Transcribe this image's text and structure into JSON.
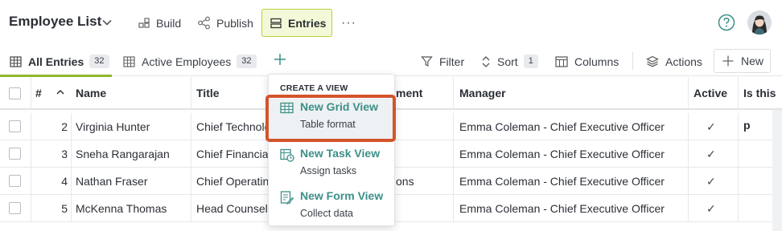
{
  "header": {
    "title": "Employee List",
    "build_label": "Build",
    "publish_label": "Publish",
    "entries_label": "Entries",
    "more_label": "···"
  },
  "views": {
    "tabs": [
      {
        "label": "All Entries",
        "count": "32",
        "active": true
      },
      {
        "label": "Active Employees",
        "count": "32",
        "active": false
      }
    ]
  },
  "toolbar": {
    "filter_label": "Filter",
    "sort_label": "Sort",
    "sort_count": "1",
    "columns_label": "Columns",
    "actions_label": "Actions",
    "new_label": "New"
  },
  "grid": {
    "columns": [
      "#",
      "Name",
      "Title",
      "ment",
      "Manager",
      "Active",
      "Is this p"
    ],
    "rows": [
      {
        "num": "2",
        "name": "Virginia Hunter",
        "title": "Chief Technolo",
        "department": "",
        "manager": "Emma Coleman - Chief Executive Officer",
        "active": "✓"
      },
      {
        "num": "3",
        "name": "Sneha Rangarajan",
        "title": "Chief Financial",
        "department": "",
        "manager": "Emma Coleman - Chief Executive Officer",
        "active": "✓"
      },
      {
        "num": "4",
        "name": "Nathan Fraser",
        "title": "Chief Operatin",
        "department": "ons",
        "manager": "Emma Coleman - Chief Executive Officer",
        "active": "✓"
      },
      {
        "num": "5",
        "name": "McKenna Thomas",
        "title": "Head Counsel",
        "department": "",
        "manager": "Emma Coleman - Chief Executive Officer",
        "active": "✓"
      }
    ]
  },
  "dropdown": {
    "heading": "CREATE A VIEW",
    "items": [
      {
        "label": "New Grid View",
        "desc": "Table format",
        "icon": "grid-view-icon"
      },
      {
        "label": "New Task View",
        "desc": "Assign tasks",
        "icon": "task-view-icon"
      },
      {
        "label": "New Form View",
        "desc": "Collect data",
        "icon": "form-view-icon"
      }
    ]
  },
  "colors": {
    "accent_green": "#8fb82b",
    "link_teal": "#3c8f87",
    "highlight_orange": "#d4542b"
  }
}
